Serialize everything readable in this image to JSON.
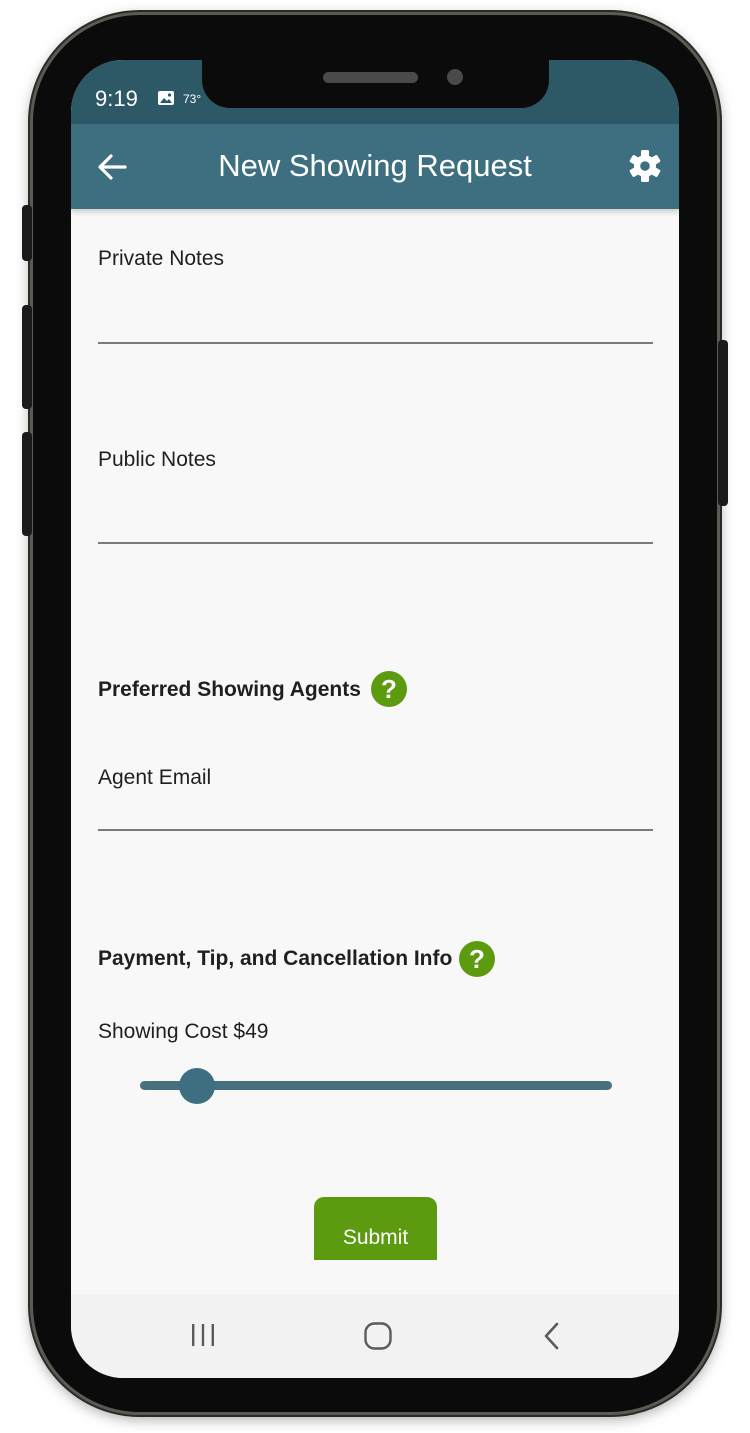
{
  "status_bar": {
    "time": "9:19",
    "temperature": "73°"
  },
  "app_bar": {
    "title": "New Showing Request"
  },
  "form": {
    "private_notes_label": "Private Notes",
    "public_notes_label": "Public Notes",
    "preferred_agents_title": "Preferred Showing Agents",
    "agent_email_label": "Agent Email",
    "payment_title": "Payment, Tip, and Cancellation Info",
    "showing_cost_label": "Showing Cost $49",
    "help_glyph": "?",
    "slider_fraction": 0.12,
    "submit_label": "Submit"
  },
  "icons": {
    "back": "arrow-left-icon",
    "settings": "gear-icon",
    "help": "question-circle-icon",
    "status_image": "image-icon",
    "nav_recents": "recents-icon",
    "nav_home": "home-icon",
    "nav_back": "back-chevron-icon"
  },
  "colors": {
    "app_bar": "#3d6f80",
    "status_bar": "#2d5966",
    "accent_green": "#5c9a10",
    "background": "#f8f8f8"
  }
}
